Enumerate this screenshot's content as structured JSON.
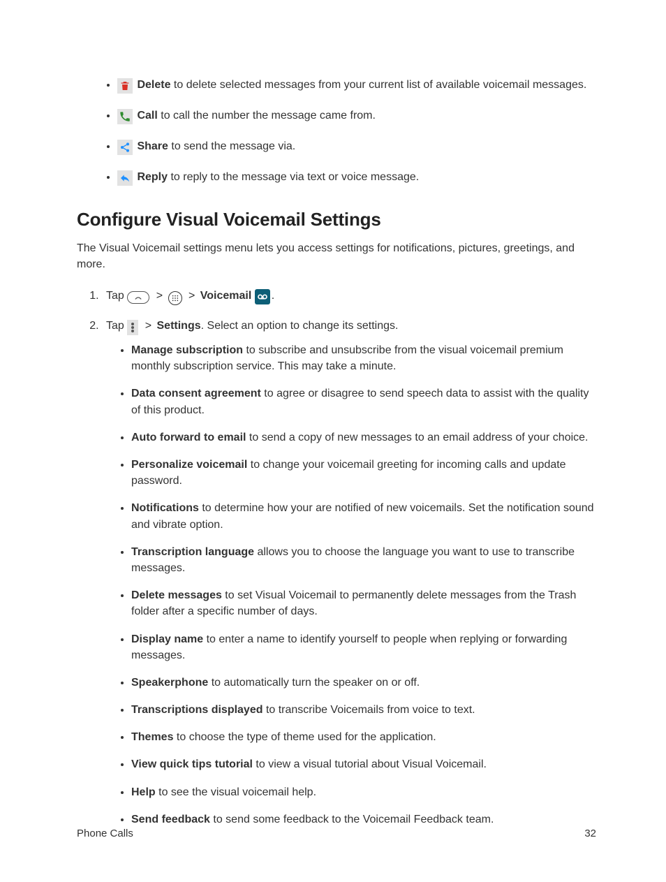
{
  "top_list": [
    {
      "icon": "trash-icon",
      "label": "Delete",
      "text": " to delete selected messages from your current list of available voicemail messages."
    },
    {
      "icon": "phone-icon",
      "label": "Call",
      "text": " to call the number the message came from."
    },
    {
      "icon": "share-icon",
      "label": "Share",
      "text": " to send the message via."
    },
    {
      "icon": "reply-icon",
      "label": "Reply",
      "text": " to reply to the message via text or voice message."
    }
  ],
  "heading": "Configure Visual Voicemail Settings",
  "lead": "The Visual Voicemail settings menu lets you access settings for notifications, pictures, greetings, and more.",
  "step1": {
    "tap": "Tap",
    "gt": ">",
    "voicemail": "Voicemail",
    "period": "."
  },
  "step2": {
    "tap": "Tap",
    "gt": ">",
    "settings": "Settings",
    "after": ". Select an option to change its settings."
  },
  "settings_list": [
    {
      "label": "Manage subscription",
      "text": " to subscribe and unsubscribe from the visual voicemail premium monthly subscription service. This may take a minute."
    },
    {
      "label": "Data consent agreement",
      "text": " to agree or disagree to send speech data to assist with the quality of this product."
    },
    {
      "label": "Auto forward to email",
      "text": " to send a copy of new messages to an email address of your choice."
    },
    {
      "label": "Personalize voicemail",
      "text": " to change your voicemail greeting for incoming calls and update password."
    },
    {
      "label": "Notifications",
      "text": " to determine how your are notified of new voicemails. Set the notification sound and vibrate option."
    },
    {
      "label": "Transcription language",
      "text": " allows you to choose the language you want to use to transcribe messages."
    },
    {
      "label": "Delete messages",
      "text": " to set Visual Voicemail to permanently delete messages from the Trash folder after a specific number of days."
    },
    {
      "label": "Display name",
      "text": " to enter a name to identify yourself to people when replying or forwarding messages."
    },
    {
      "label": "Speakerphone",
      "text": " to automatically turn the speaker on or off."
    },
    {
      "label": "Transcriptions displayed",
      "text": " to transcribe Voicemails from voice to text."
    },
    {
      "label": "Themes",
      "text": " to choose the type of theme used for the application."
    },
    {
      "label": "View quick tips tutorial",
      "text": " to view a visual tutorial about Visual Voicemail."
    },
    {
      "label": "Help",
      "text": " to see the visual voicemail help."
    },
    {
      "label": "Send feedback",
      "text": " to send some feedback to the Voicemail Feedback team."
    }
  ],
  "footer": {
    "section": "Phone Calls",
    "page": "32"
  }
}
